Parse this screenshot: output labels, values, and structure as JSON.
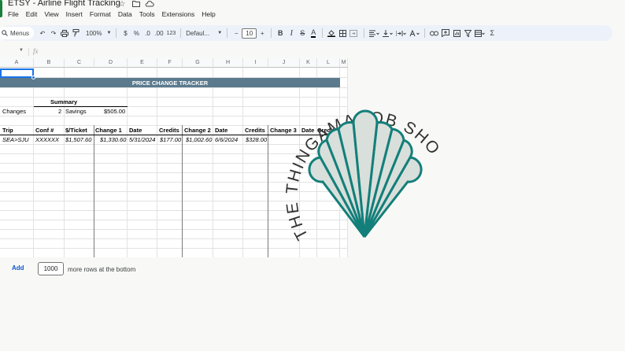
{
  "app": {
    "doc_title": "ETSY - Airline Flight Tracking",
    "menu": [
      "File",
      "Edit",
      "View",
      "Insert",
      "Format",
      "Data",
      "Tools",
      "Extensions",
      "Help"
    ]
  },
  "toolbar": {
    "menus_label": "Menus",
    "zoom": "100%",
    "currency": "$",
    "percent": "%",
    "dec_decrease": ".0",
    "dec_increase": ".00",
    "number_format": "123",
    "font": "Defaul...",
    "minus": "−",
    "font_size": "10",
    "plus": "+",
    "bold": "B",
    "italic": "I",
    "strike": "S",
    "text_color": "A",
    "sigma": "Σ"
  },
  "formula_bar": {
    "fx": "fx",
    "value": ""
  },
  "sheet": {
    "columns": [
      "A",
      "B",
      "C",
      "D",
      "E",
      "F",
      "G",
      "H",
      "I",
      "J",
      "K",
      "L",
      "M"
    ],
    "banner": "PRICE CHANGE TRACKER",
    "summary": {
      "title": "Summary",
      "changes_label": "Changes",
      "changes_value": "2",
      "savings_label": "Savings",
      "savings_value": "$505.00"
    },
    "headers": [
      "Trip",
      "Conf #",
      "$/Ticket",
      "Change 1",
      "Date",
      "Credits",
      "Change 2",
      "Date",
      "Credits",
      "Change 3",
      "Date",
      "Credits"
    ],
    "row1": [
      "SEA>SJU",
      "XXXXXX",
      "$1,507.60",
      "$1,330.60",
      "5/31/2024",
      "$177.00",
      "$1,002.60",
      "6/6/2024",
      "$328.00"
    ]
  },
  "add_rows": {
    "button": "Add",
    "count": "1000",
    "suffix": "more rows at the bottom"
  },
  "stamp": {
    "text": "THE THINGAMABOB SHOP",
    "fill_color": "#d9dfdb",
    "stroke_color": "#137f7a",
    "text_color": "#333333"
  },
  "colors": {
    "banner": "#5b7a8e",
    "selection": "#1a73e8",
    "toolbar_bg": "#edf2fa"
  }
}
